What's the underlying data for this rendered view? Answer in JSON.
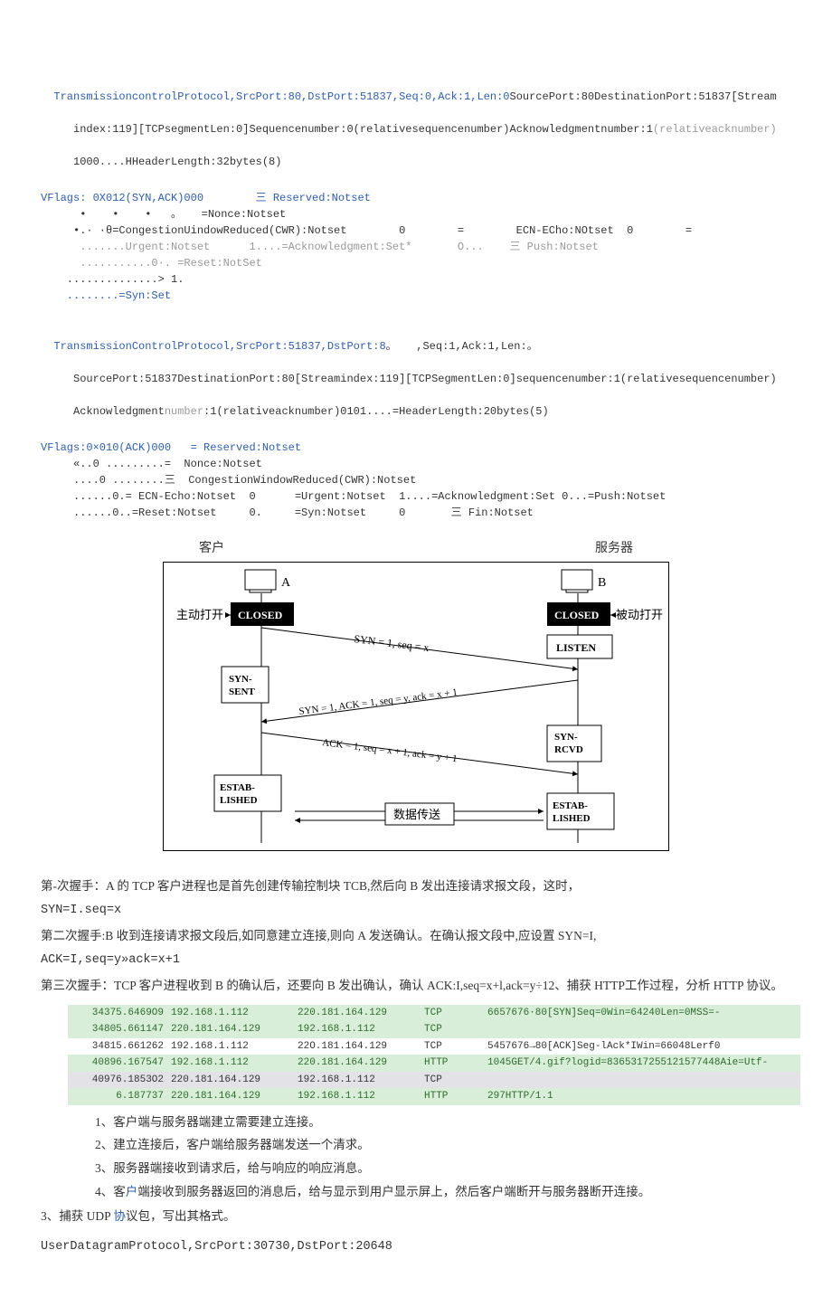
{
  "block1": {
    "line1a": "TransmissioncontrolProtocol,SrcPort:80,DstPort:51837,Seq:0,Ack:1,Len:0",
    "line1b": "SourcePort:80DestinationPort:51837[Stream",
    "line2": "   index:119][TCPsegmentLen:0]Sequencenumber:0(relativesequencenumber)Acknowledgmentnumber:1",
    "line2b": "(relativeacknumber)",
    "line3": "   1000....HHeaderLength:32bytes(8)",
    "flags_title": "VFlags: 0X012(SYN,ACK)000        三 Reserved:Notset",
    "nonce": "      •    •    •   。   =Nonce:Notset",
    "cwr": "     •.· ·θ=CongestionUindowReduced(CWR):Notset        0        =        ECN-ECho:NOtset  0        =",
    "urgent": "      .......Urgent:Notset      1....=Acknowledgment:Set*       O...    三 Push:Notset",
    "reset": "      ...........0·. =Reset:NotSet",
    "dots": "    ..............> 1.",
    "syn": "    ........=Syn:Set"
  },
  "block2": {
    "line1a": "TransmissionControlProtocol,SrcPort:51837,DstPort:8",
    "line1b": "。   ,Seq:1,Ack:1,Len:",
    "line1c": "。",
    "line2": "   SourcePort:51837DestinationPort:80[Streamindex:119][TCPSegmentLen:0]sequencenumber:1(relativesequencenumber)",
    "line3": "   Acknowledgmentnumber:1(relativeacknumber)0101....=HeaderLength:20bytes(5)",
    "flags_title": "VFlags:0×010(ACK)000   = Reserved:Notset",
    "nonce": "     «..0 .........=  Nonce:Notset",
    "cwr": "     ....0 ........三  CongestionWindowReduced(CWR):Notset",
    "ecn": "     ......0.= ECN-Echo:Notset  0      =Urgent:Notset  1....=Acknowledgment:Set 0...=Push:Notset",
    "reset": "     ......0..=Reset:Notset     0.     =Syn:Notset     0       三 Fin:Notset"
  },
  "diagram": {
    "client": "客户",
    "server": "服务器",
    "A": "A",
    "B": "B",
    "active_open": "主动打开",
    "passive_open": "被动打开",
    "closed": "CLOSED",
    "listen": "LISTEN",
    "syn_sent": "SYN-SENT",
    "syn_rcvd": "SYN-RCVD",
    "established": "ESTAB-LISHED",
    "syn1": "SYN = 1, seq = x",
    "syn2": "SYN = 1, ACK = 1, seq = y, ack = x + 1",
    "ack3": "ACK = 1, seq = x + 1, ack = y + 1",
    "data_transfer": "数据传送"
  },
  "para": {
    "p1": "第-次握手：A 的 TCP 客户进程也是首先创建传输控制块 TCB,然后向 B 发出连接请求报文段，这时，",
    "p1b": "SYN=I.seq=x",
    "p2": "第二次握手:B 收到连接请求报文段后,如同意建立连接,则向 A 发送确认。在确认报文段中,应设置 SYN=I,",
    "p2b": "ACK=I,seq=y»ack=x+1",
    "p3": "第三次握手：TCP 客户进程收到 B 的确认后，还要向 B 发出确认，确认 ACK:I,seq=x+l,ack=y÷12、捕获 HTTP工作过程，分析 HTTP 协议。"
  },
  "packets": [
    {
      "cls": "row-green",
      "time": "34375.6469O9",
      "src": "192.168.1.112",
      "dst": "220.181.164.129",
      "proto": "TCP",
      "info": "6657676·80[SYN]Seq=0Win=64240Len=0MSS=-"
    },
    {
      "cls": "row-green",
      "time": "34805.661147",
      "src": "220.181.164.129",
      "dst": "192.168.1.112",
      "proto": "TCP",
      "info": ""
    },
    {
      "cls": "row-white",
      "time": "34815.661262",
      "src": "192.168.1.112",
      "dst": "22O.181.164.129",
      "proto": "TCP",
      "info": "5457676→80[ACK]Seg-lAck*IWin=66048Lerf0"
    },
    {
      "cls": "row-green",
      "time": "40896.167547",
      "src": "192.168.1.112",
      "dst": "220.181.164.129",
      "proto": "HTTP",
      "info": "1045GET/4.gif?logid=8365317255121577448Aie=Utf-"
    },
    {
      "cls": "row-gray",
      "time": "40976.1853O2",
      "src": "220.181.164.129",
      "dst": "192.168.1.112",
      "proto": "TCP",
      "info": ""
    },
    {
      "cls": "row-green",
      "time": "6.187737",
      "src": "220.181.164.129",
      "dst": "192.168.1.112",
      "proto": "HTTP",
      "info": "297HTTP/1.1"
    }
  ],
  "list": {
    "i1": "1、客户端与服务器端建立需要建立连接。",
    "i2": "2、建立连接后，客户端给服务器端发送一个清求。",
    "i3": "3、服务器端接收到请求后，给与响应的响应消息。",
    "i4": "4、客户端接收到服务器返回的消息后，给与显示到用户显示屏上，然后客户端断开与服务器断开连接。"
  },
  "footer": {
    "line1": "3、捕获 UDP 协议包，写出其格式。",
    "line2": "UserDatagramProtocol,SrcPort:30730,DstPort:20648"
  }
}
